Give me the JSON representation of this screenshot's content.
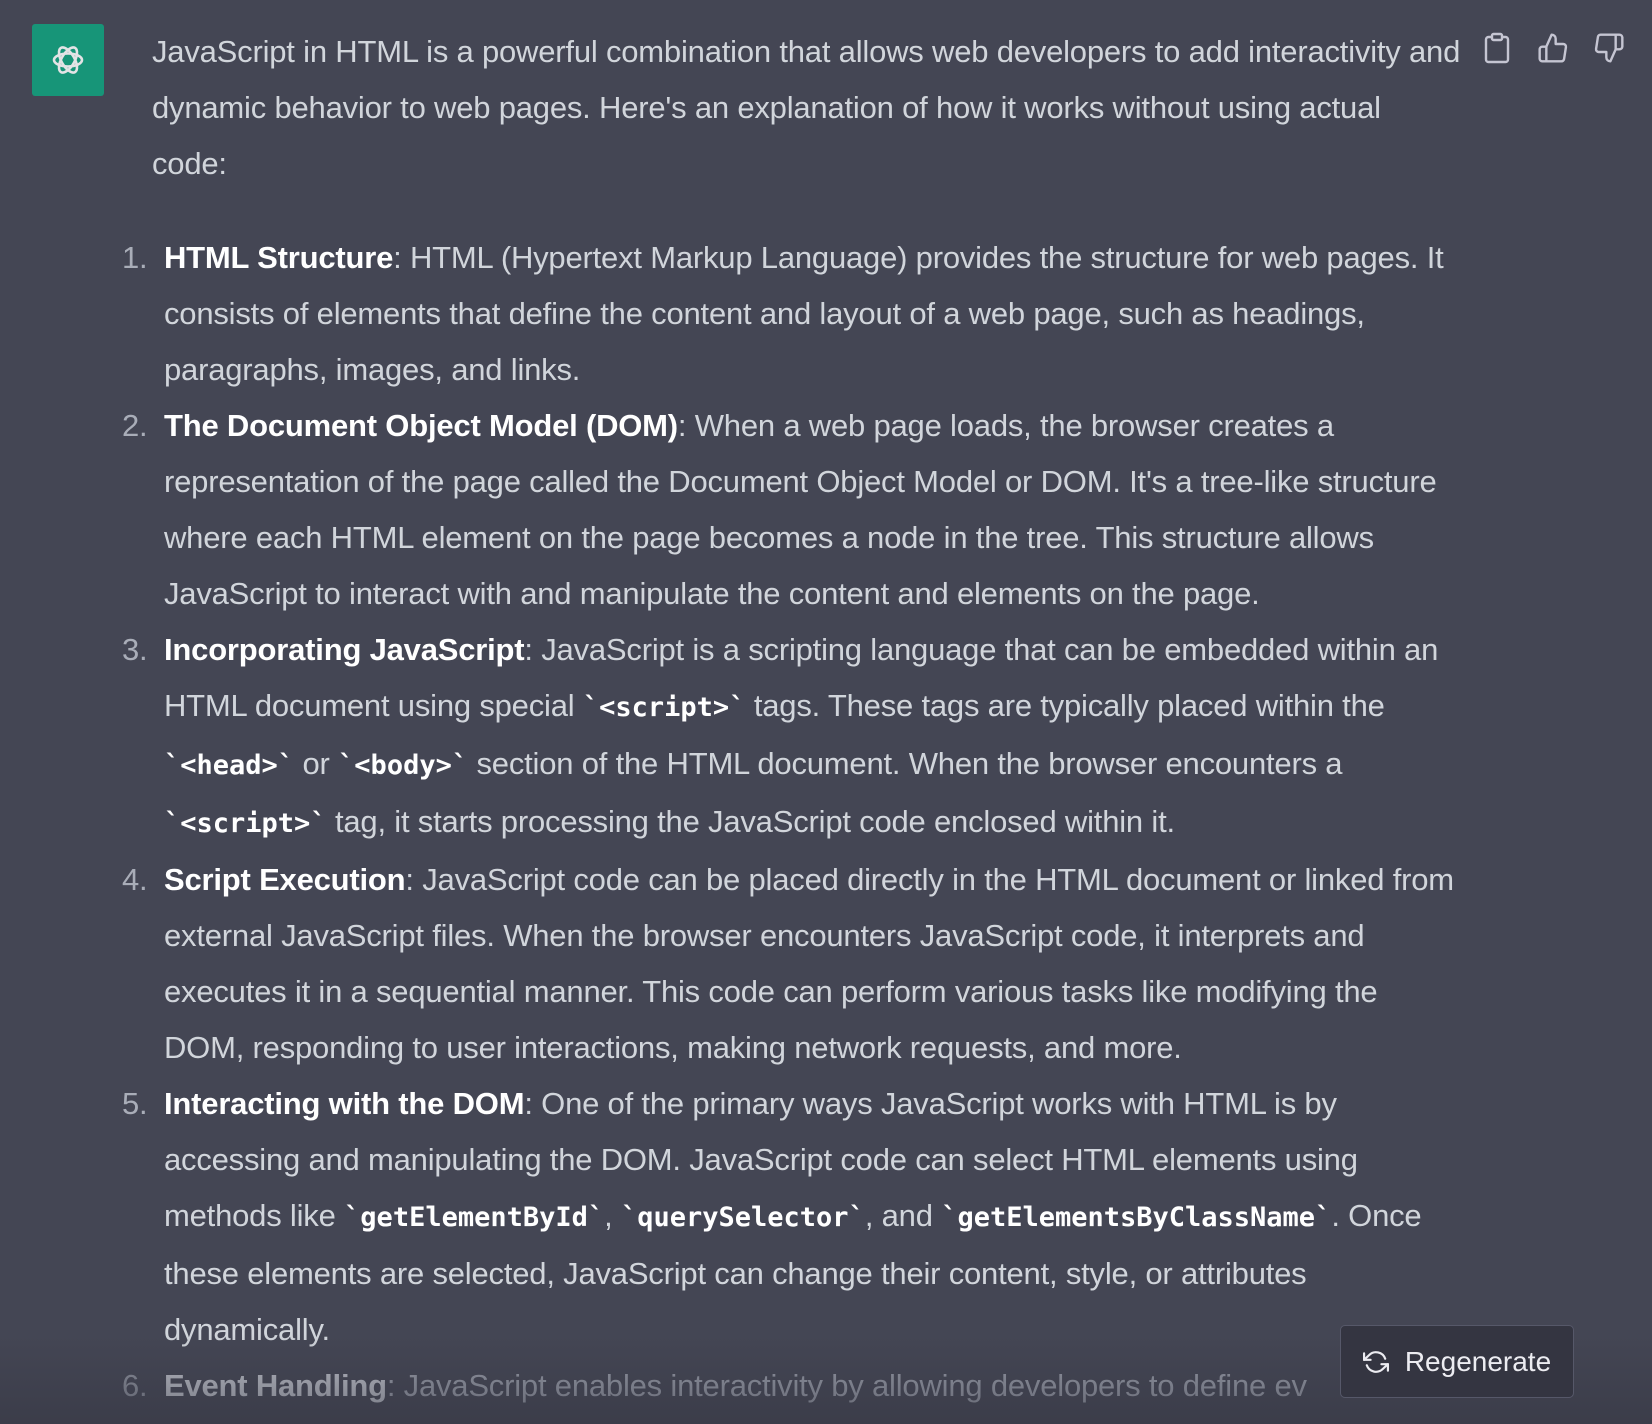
{
  "assistant": {
    "avatar_icon": "openai-logo-icon",
    "avatar_color": "#10a37f"
  },
  "actions": {
    "copy_icon": "clipboard-icon",
    "like_icon": "thumbs-up-icon",
    "dislike_icon": "thumbs-down-icon"
  },
  "message": {
    "intro": "JavaScript in HTML is a powerful combination that allows web developers to add interactivity and dynamic behavior to web pages. Here's an explanation of how it works without using actual code:",
    "items": [
      {
        "number": "1.",
        "title": "HTML Structure",
        "text": ": HTML (Hypertext Markup Language) provides the structure for web pages. It consists of elements that define the content and layout of a web page, such as headings, paragraphs, images, and links."
      },
      {
        "number": "2.",
        "title": "The Document Object Model (DOM)",
        "text": ": When a web page loads, the browser creates a representation of the page called the Document Object Model or DOM. It's a tree-like structure where each HTML element on the page becomes a node in the tree. This structure allows JavaScript to interact with and manipulate the content and elements on the page."
      },
      {
        "number": "3.",
        "title": "Incorporating JavaScript",
        "t1": ": JavaScript is a scripting language that can be embedded within an HTML document using special ",
        "c1": "`<script>`",
        "t2": " tags. These tags are typically placed within the ",
        "c2": "`<head>`",
        "t3": " or ",
        "c3": "`<body>`",
        "t4": " section of the HTML document. When the browser encounters a ",
        "c4": "`<script>`",
        "t5": " tag, it starts processing the JavaScript code enclosed within it."
      },
      {
        "number": "4.",
        "title": "Script Execution",
        "text": ": JavaScript code can be placed directly in the HTML document or linked from external JavaScript files. When the browser encounters JavaScript code, it interprets and executes it in a sequential manner. This code can perform various tasks like modifying the DOM, responding to user interactions, making network requests, and more."
      },
      {
        "number": "5.",
        "title": "Interacting with the DOM",
        "t1": ": One of the primary ways JavaScript works with HTML is by accessing and manipulating the DOM. JavaScript code can select HTML elements using methods like ",
        "c1": "`getElementById`",
        "t2": ", ",
        "c2": "`querySelector`",
        "t3": ", and ",
        "c3": "`getElementsByClassName`",
        "t4": ". Once these elements are selected, JavaScript can change their content, style, or attributes dynamically."
      },
      {
        "number": "6.",
        "title": "Event Handling",
        "text": ": JavaScript enables interactivity by allowing developers to define ev"
      }
    ]
  },
  "regenerate": {
    "label": "Regenerate",
    "icon": "refresh-icon"
  }
}
